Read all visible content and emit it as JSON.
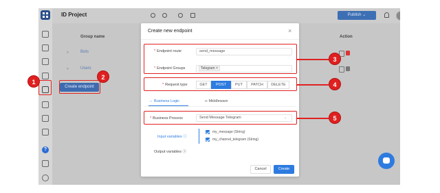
{
  "app": {
    "project_title": "ID Project",
    "publish_label": "Publish"
  },
  "table": {
    "col_group": "Group name",
    "col_action": "Action",
    "rows": [
      "Bots",
      "Users"
    ],
    "create_endpoint_label": "Create endpoint"
  },
  "modal": {
    "title": "Create new endpoint",
    "close": "×",
    "route_label": "Endpoint route",
    "route_value": "send_message",
    "groups_label": "Endpoint Groups",
    "group_tag": "Telegram ×",
    "request_label": "Request type",
    "methods": [
      "GET",
      "POST",
      "PUT",
      "PATCH",
      "DELETE"
    ],
    "active_method": "POST",
    "tabs": {
      "business_logic": "Business Logic",
      "middleware": "Middleware"
    },
    "process_label": "Business Process",
    "process_value": "Send Message Telegram",
    "input_vars_label": "Input variables",
    "output_vars_label": "Output variables",
    "variables": [
      "my_message (String)",
      "my_channel_telegram (String)"
    ],
    "cancel_label": "Cancel",
    "create_label": "Create"
  },
  "annotations": [
    "1",
    "2",
    "3",
    "4",
    "5"
  ],
  "colors": {
    "accent": "#2d7be0",
    "highlight": "#e02020"
  }
}
